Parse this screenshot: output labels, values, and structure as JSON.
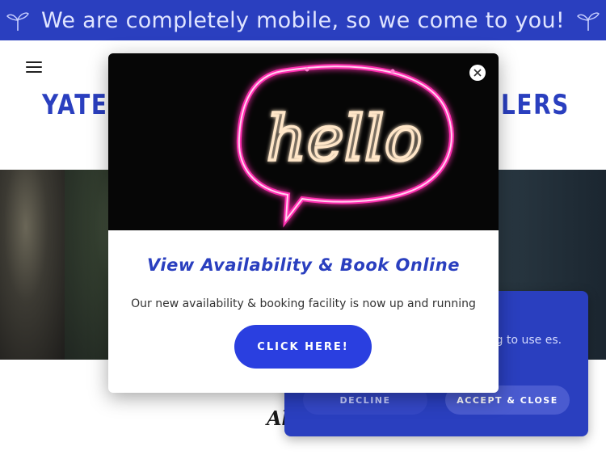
{
  "announcement": {
    "text": "We are completely mobile, so we come to you!",
    "icon_left": "sprout-icon",
    "icon_right": "sprout-icon"
  },
  "header": {
    "menu_icon": "hamburger-icon",
    "brand_left": "YATES",
    "brand_right": "ILERS"
  },
  "lower": {
    "heading_fragment": "Ab"
  },
  "modal": {
    "image_text": "hello",
    "title": "View Availability & Book Online",
    "text": "Our new availability & booking facility is now up and running",
    "cta_label": "CLICK HERE!",
    "close_icon": "close-icon"
  },
  "cookie": {
    "text_fragment": "uing to use es.",
    "decline_label": "DECLINE",
    "accept_label": "ACCEPT & CLOSE"
  },
  "colors": {
    "brand_blue": "#2a3fbf",
    "cta_blue": "#2a3fe0",
    "neon_pink": "#ff2fb0"
  }
}
